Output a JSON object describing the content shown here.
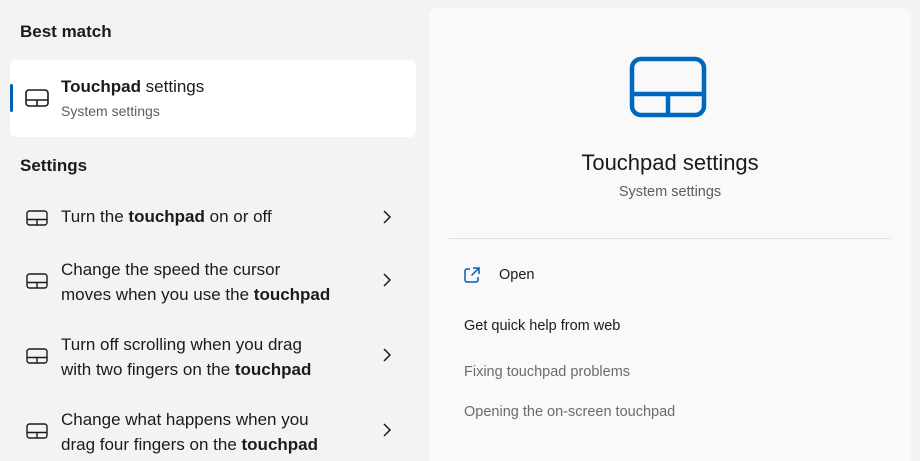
{
  "left": {
    "best_match_heading": "Best match",
    "best_match": {
      "title_bold": "Touchpad",
      "title_rest": " settings",
      "subtitle": "System settings"
    },
    "settings_heading": "Settings",
    "results": [
      {
        "line1_pre": "Turn the ",
        "line1_bold": "touchpad",
        "line1_post": " on or off",
        "line2_pre": "",
        "line2_bold": ""
      },
      {
        "line1_pre": "Change the speed the cursor",
        "line1_bold": "",
        "line1_post": "",
        "line2_pre": "moves when you use the ",
        "line2_bold": "touchpad"
      },
      {
        "line1_pre": "Turn off scrolling when you drag",
        "line1_bold": "",
        "line1_post": "",
        "line2_pre": "with two fingers on the ",
        "line2_bold": "touchpad"
      },
      {
        "line1_pre": "Change what happens when you",
        "line1_bold": "",
        "line1_post": "",
        "line2_pre": "drag four fingers on the ",
        "line2_bold": "touchpad"
      }
    ]
  },
  "right": {
    "title": "Touchpad settings",
    "subtitle": "System settings",
    "open_label": "Open",
    "help_heading": "Get quick help from web",
    "help_links": [
      "Fixing touchpad problems",
      "Opening the on-screen touchpad"
    ]
  },
  "colors": {
    "accent": "#005fb8",
    "hero_icon": "#0067c0"
  },
  "icons": {
    "result": "touchpad-icon",
    "chevron": "chevron-right-icon",
    "open": "open-external-icon"
  }
}
